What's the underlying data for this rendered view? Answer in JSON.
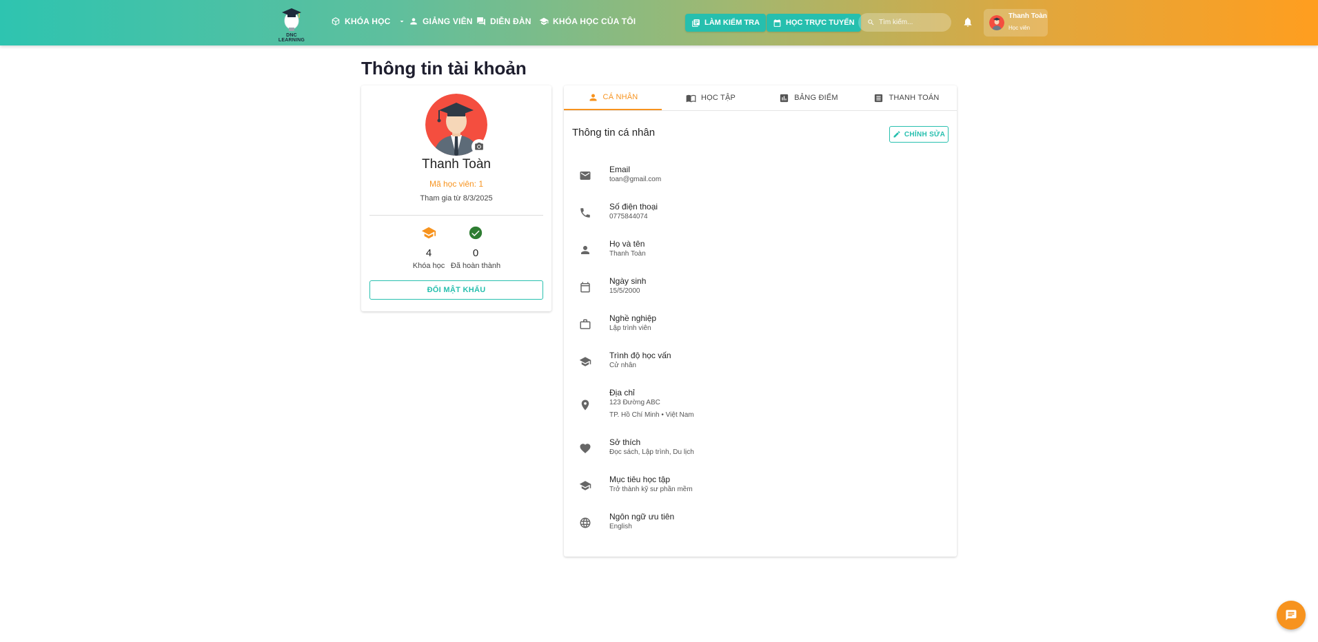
{
  "brand": {
    "logo_text": "DNC LEARNING"
  },
  "nav": {
    "courses": "KHÓA HỌC",
    "instructors": "GIẢNG VIÊN",
    "forum": "DIỄN ĐÀN",
    "my_courses": "KHÓA HỌC CỦA TÔI"
  },
  "header": {
    "test_button": "LÀM KIỂM TRA",
    "online_button": "HỌC TRỰC TUYẾN",
    "search_placeholder": "Tìm kiếm...",
    "user_name": "Thanh Toàn",
    "user_role": "Học viên"
  },
  "page_title": "Thông tin tài khoản",
  "profile": {
    "name": "Thanh Toàn",
    "student_id": "Mã học viên: 1",
    "joined": "Tham gia từ 8/3/2025",
    "stats": [
      {
        "value": "4",
        "label": "Khóa học"
      },
      {
        "value": "0",
        "label": "Đã hoàn thành"
      }
    ],
    "change_password": "ĐỔI MẬT KHẨU"
  },
  "tabs": [
    "CÁ NHÂN",
    "HỌC TẬP",
    "BẢNG ĐIỂM",
    "THANH TOÁN"
  ],
  "personal": {
    "title": "Thông tin cá nhân",
    "edit": "CHỈNH SỬA",
    "fields": [
      {
        "label": "Email",
        "value": "toan@gmail.com",
        "icon": "mail-icon"
      },
      {
        "label": "Số điện thoại",
        "value": "0775844074",
        "icon": "phone-icon"
      },
      {
        "label": "Họ và tên",
        "value": "Thanh Toàn",
        "icon": "person-icon"
      },
      {
        "label": "Ngày sinh",
        "value": "15/5/2000",
        "icon": "calendar-icon"
      },
      {
        "label": "Nghề nghiệp",
        "value": "Lập trình viên",
        "icon": "briefcase-icon"
      },
      {
        "label": "Trình độ học vấn",
        "value": "Cử nhân",
        "icon": "school-icon"
      },
      {
        "label": "Địa chỉ",
        "value": "123 Đường ABC",
        "value2": "TP. Hồ Chí Minh  •  Việt Nam",
        "icon": "location-icon"
      },
      {
        "label": "Sở thích",
        "value": "Đọc sách, Lập trình, Du lịch",
        "icon": "heart-icon"
      },
      {
        "label": "Mục tiêu học tập",
        "value": "Trở thành kỹ sư phần mềm",
        "icon": "school-icon"
      },
      {
        "label": "Ngôn ngữ ưu tiên",
        "value": "English",
        "icon": "globe-icon"
      }
    ]
  },
  "colors": {
    "primary": "#26bfae",
    "accent": "#f7931e",
    "success": "#2e7d32"
  }
}
